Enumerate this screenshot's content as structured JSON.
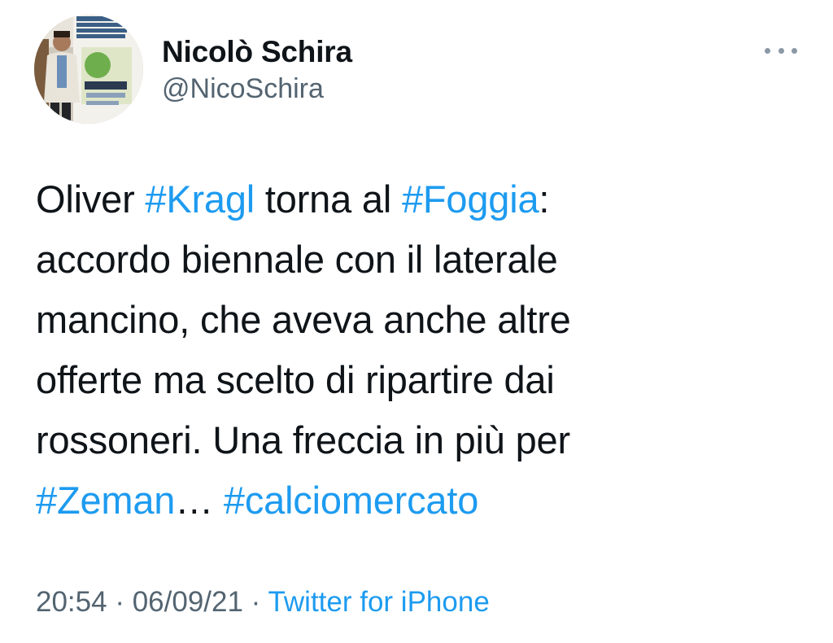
{
  "author": {
    "display_name": "Nicolò Schira",
    "handle": "@NicoSchira"
  },
  "icons": {
    "more": "more-horizontal-icon",
    "avatar": "profile-photo"
  },
  "tweet": {
    "lines": [
      [
        {
          "text": "Oliver ",
          "type": "text"
        },
        {
          "text": "#Kragl",
          "type": "hashtag"
        },
        {
          "text": " torna al ",
          "type": "text"
        },
        {
          "text": "#Foggia",
          "type": "hashtag"
        },
        {
          "text": ":",
          "type": "text"
        }
      ],
      [
        {
          "text": "accordo biennale con il laterale",
          "type": "text"
        }
      ],
      [
        {
          "text": "mancino, che aveva anche altre",
          "type": "text"
        }
      ],
      [
        {
          "text": "offerte ma scelto di ripartire dai",
          "type": "text"
        }
      ],
      [
        {
          "text": "rossoneri. Una freccia in più per",
          "type": "text"
        }
      ],
      [
        {
          "text": "#Zeman",
          "type": "hashtag"
        },
        {
          "text": "… ",
          "type": "text"
        },
        {
          "text": "#calciomercato",
          "type": "hashtag"
        }
      ]
    ]
  },
  "meta": {
    "time": "20:54",
    "separator": " · ",
    "date": "06/09/21",
    "source": "Twitter for iPhone"
  },
  "colors": {
    "link": "#1d9bf0",
    "secondary_text": "#536471",
    "primary_text": "#0f1419"
  }
}
